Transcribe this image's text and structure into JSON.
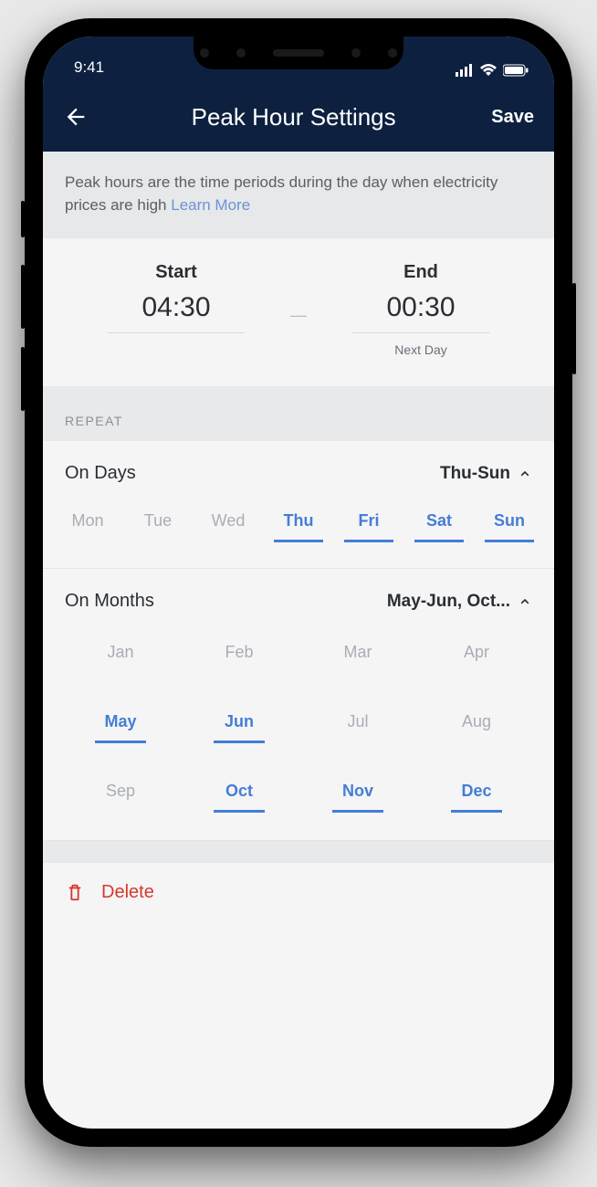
{
  "status": {
    "time": "9:41"
  },
  "header": {
    "title": "Peak Hour Settings",
    "save": "Save"
  },
  "info": {
    "text": "Peak hours are the time periods during the day when electricity prices are high ",
    "link": "Learn More"
  },
  "time": {
    "start_label": "Start",
    "start_value": "04:30",
    "end_label": "End",
    "end_value": "00:30",
    "end_sub": "Next Day"
  },
  "repeat_header": "REPEAT",
  "days": {
    "label": "On Days",
    "summary": "Thu-Sun",
    "items": [
      {
        "label": "Mon",
        "selected": false
      },
      {
        "label": "Tue",
        "selected": false
      },
      {
        "label": "Wed",
        "selected": false
      },
      {
        "label": "Thu",
        "selected": true
      },
      {
        "label": "Fri",
        "selected": true
      },
      {
        "label": "Sat",
        "selected": true
      },
      {
        "label": "Sun",
        "selected": true
      }
    ]
  },
  "months": {
    "label": "On Months",
    "summary": "May-Jun, Oct...",
    "items": [
      {
        "label": "Jan",
        "selected": false
      },
      {
        "label": "Feb",
        "selected": false
      },
      {
        "label": "Mar",
        "selected": false
      },
      {
        "label": "Apr",
        "selected": false
      },
      {
        "label": "May",
        "selected": true
      },
      {
        "label": "Jun",
        "selected": true
      },
      {
        "label": "Jul",
        "selected": false
      },
      {
        "label": "Aug",
        "selected": false
      },
      {
        "label": "Sep",
        "selected": false
      },
      {
        "label": "Oct",
        "selected": true
      },
      {
        "label": "Nov",
        "selected": true
      },
      {
        "label": "Dec",
        "selected": true
      }
    ]
  },
  "delete": {
    "label": "Delete"
  }
}
